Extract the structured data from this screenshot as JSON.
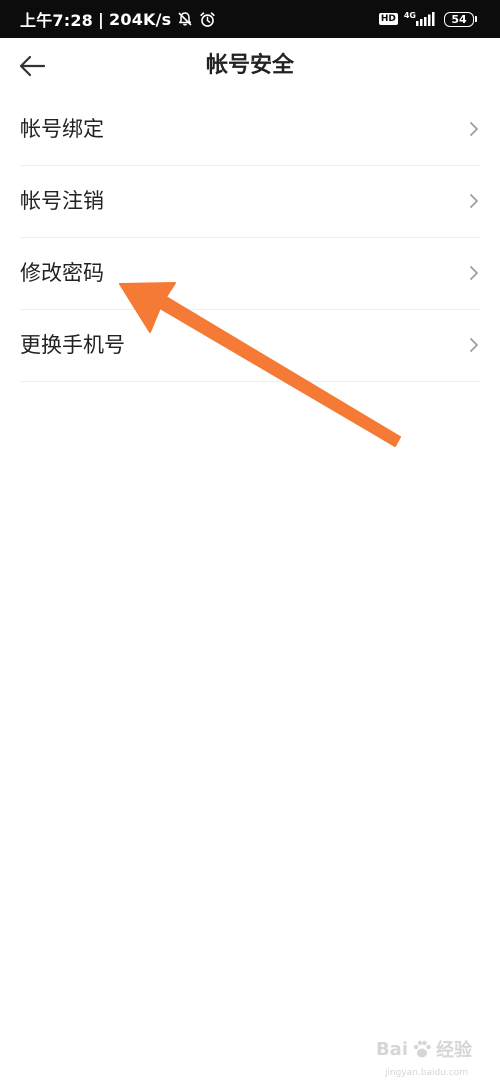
{
  "status_bar": {
    "time": "上午7:28",
    "separator": "|",
    "net_speed": "204K/s",
    "hd_badge": "HD",
    "network_type": "4G",
    "battery": "54",
    "icons": [
      "bell-off-icon",
      "alarm-icon",
      "hd-icon",
      "signal-icon",
      "battery-icon"
    ]
  },
  "header": {
    "back_icon": "arrow-left-icon",
    "title": "帐号安全"
  },
  "menu": {
    "items": [
      {
        "label": "帐号绑定",
        "icon": "chevron-right-icon"
      },
      {
        "label": "帐号注销",
        "icon": "chevron-right-icon"
      },
      {
        "label": "修改密码",
        "icon": "chevron-right-icon"
      },
      {
        "label": "更换手机号",
        "icon": "chevron-right-icon"
      }
    ]
  },
  "annotation": {
    "color": "#f47a35",
    "points_to": "修改密码"
  },
  "watermark": {
    "brand_left": "Bai",
    "brand_right": "经验",
    "url": "jingyan.baidu.com"
  },
  "colors": {
    "status_bar_bg": "#0c0c0c",
    "text_primary": "#222222",
    "divider": "#eeeeee",
    "chevron": "#9aa0a6",
    "arrow": "#f47a35"
  }
}
